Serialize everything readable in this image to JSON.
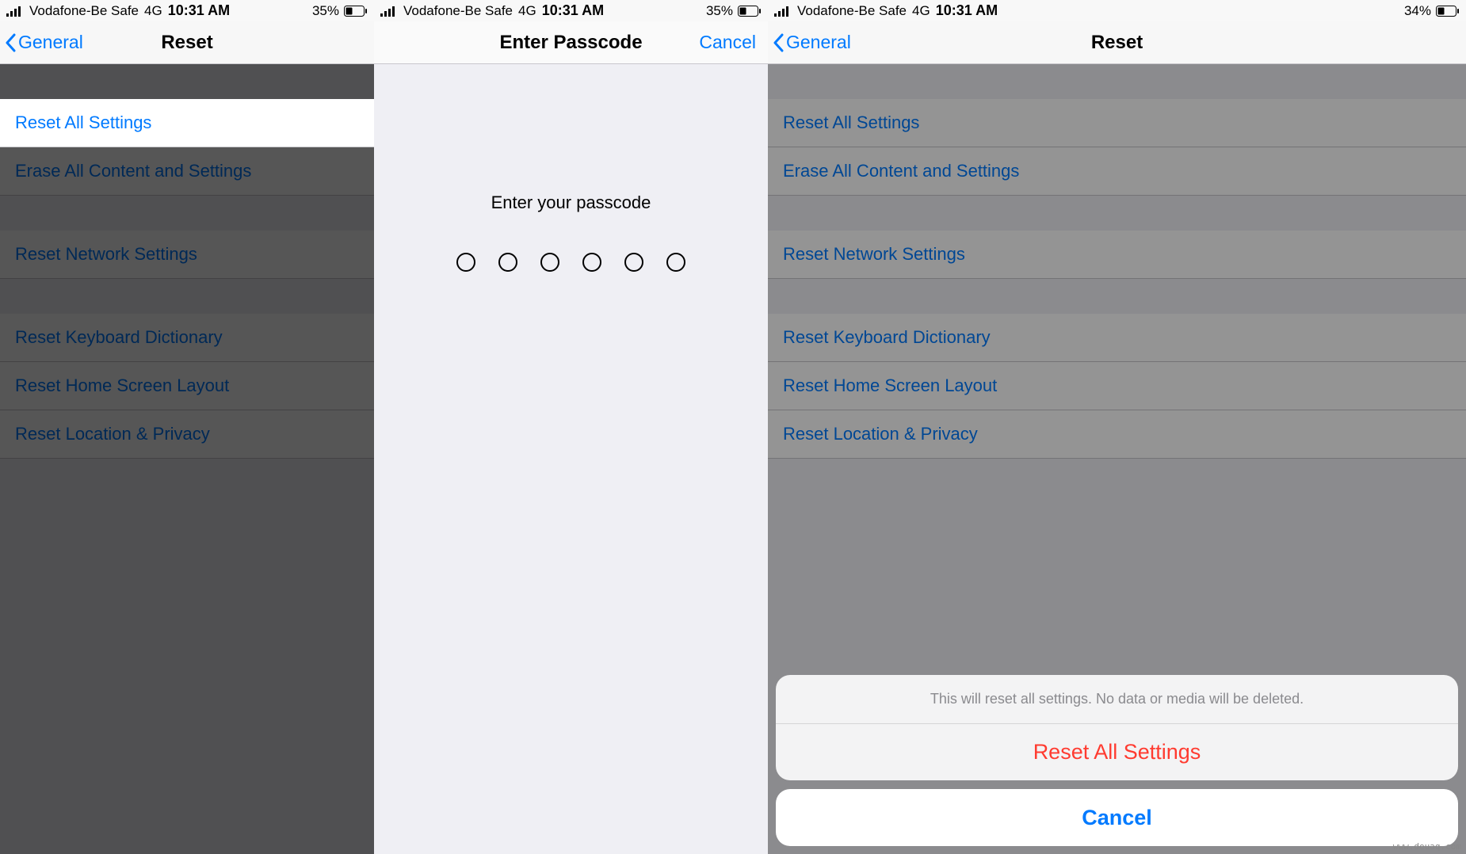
{
  "status": {
    "carrier": "Vodafone-Be Safe",
    "network": "4G",
    "time": "10:31 AM",
    "battery_1": "35%",
    "battery_2": "35%",
    "battery_3": "34%"
  },
  "nav": {
    "back_label": "General",
    "title": "Reset",
    "passcode_title": "Enter Passcode",
    "cancel": "Cancel"
  },
  "reset_items": {
    "reset_all": "Reset All Settings",
    "erase_all": "Erase All Content and Settings",
    "network": "Reset Network Settings",
    "keyboard": "Reset Keyboard Dictionary",
    "home": "Reset Home Screen Layout",
    "location": "Reset Location & Privacy"
  },
  "passcode": {
    "prompt": "Enter your passcode",
    "digits": 6
  },
  "action_sheet": {
    "message": "This will reset all settings. No data or media will be deleted.",
    "confirm": "Reset All Settings",
    "cancel": "Cancel"
  },
  "watermark": "www.deuaq.com"
}
